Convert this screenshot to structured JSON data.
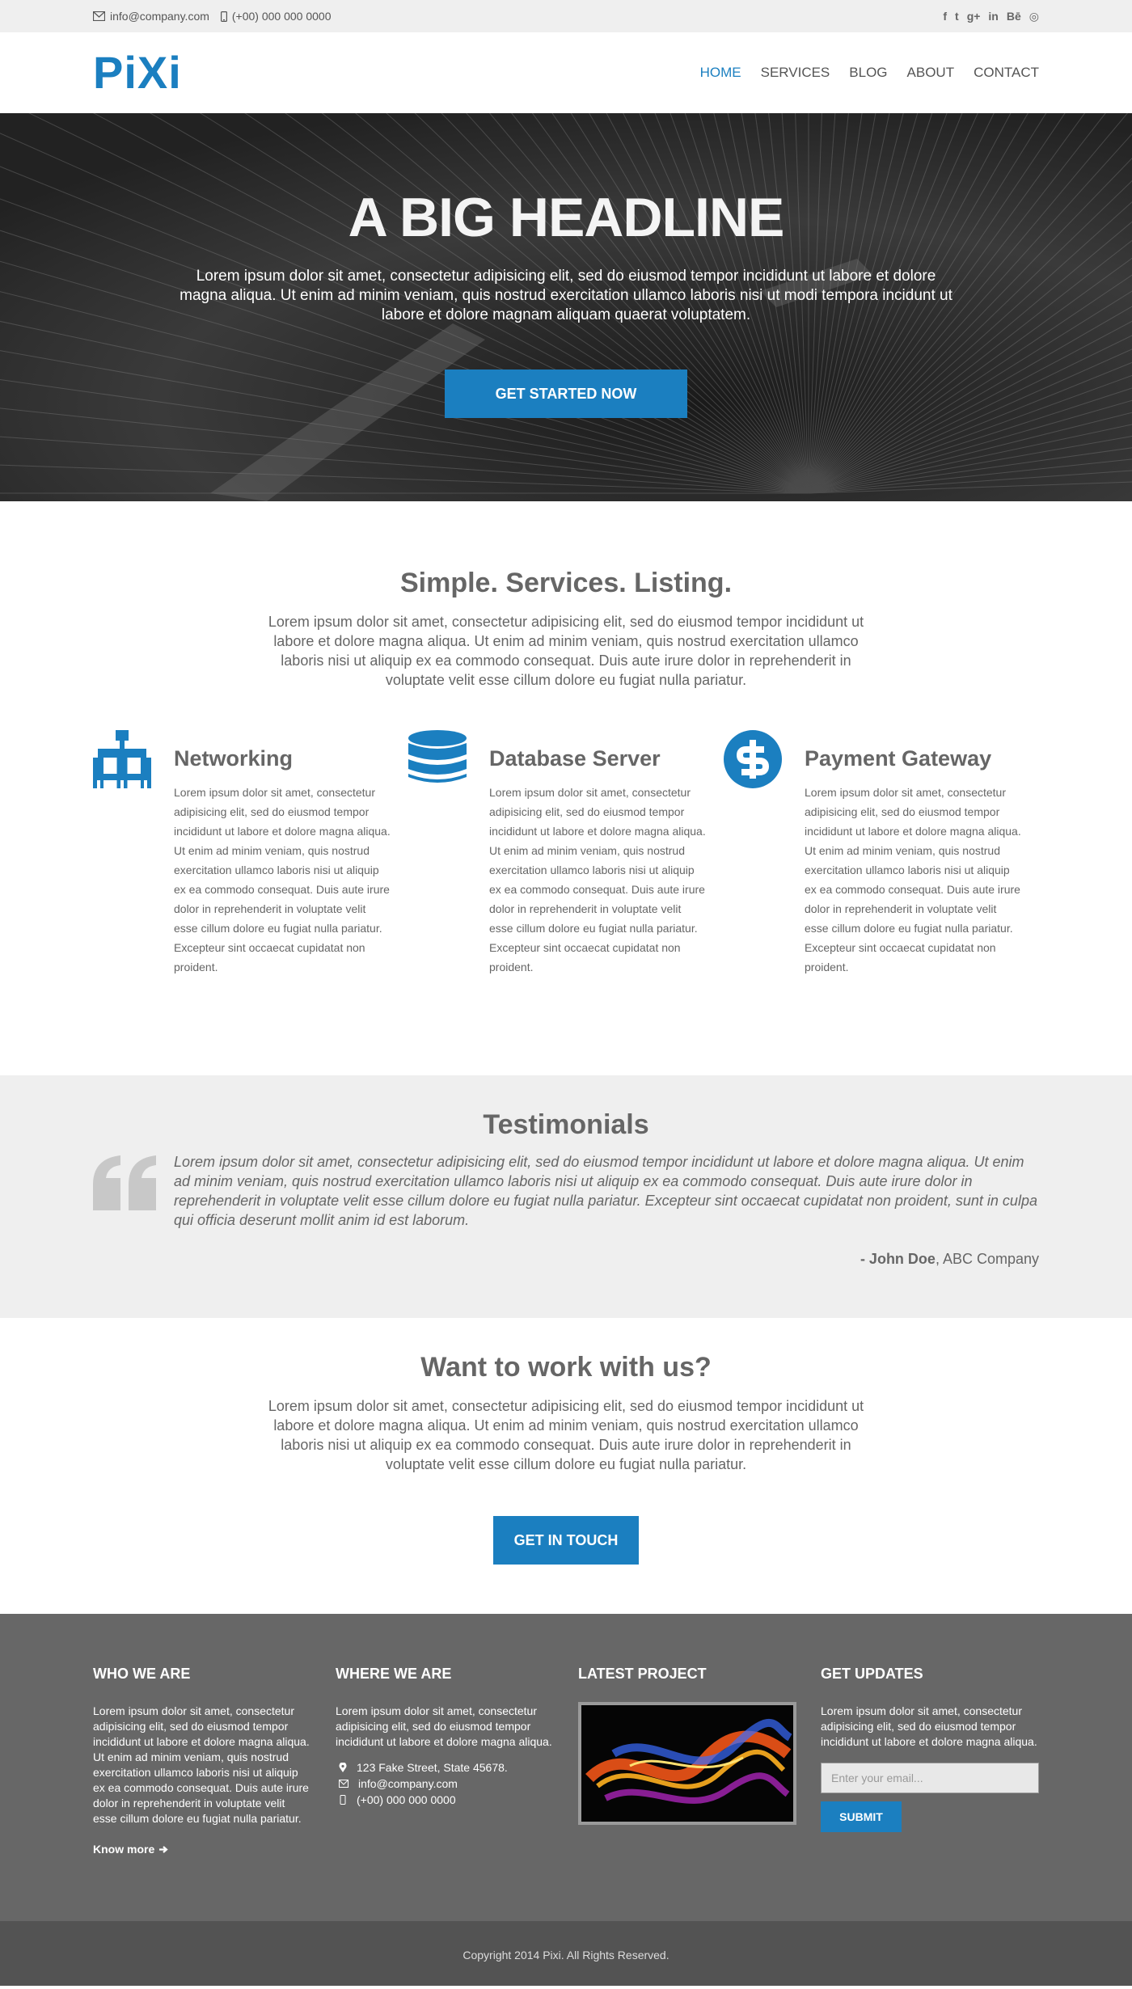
{
  "topbar": {
    "email": "info@company.com",
    "phone": "(+00) 000 000 0000",
    "social": [
      "f",
      "t",
      "g+",
      "in",
      "Bē",
      "◎"
    ]
  },
  "header": {
    "logo": "PiXi",
    "nav": [
      "HOME",
      "SERVICES",
      "BLOG",
      "ABOUT",
      "CONTACT"
    ],
    "active": "HOME"
  },
  "hero": {
    "headline": "A BIG HEADLINE",
    "text": "Lorem ipsum dolor sit amet, consectetur adipisicing elit, sed do eiusmod tempor incididunt ut labore et dolore magna aliqua. Ut enim ad minim veniam, quis nostrud exercitation ullamco laboris nisi ut modi tempora incidunt ut labore et dolore magnam aliquam quaerat voluptatem.",
    "cta": "GET STARTED NOW"
  },
  "services": {
    "title": "Simple. Services. Listing.",
    "intro": "Lorem ipsum dolor sit amet, consectetur adipisicing elit, sed do eiusmod tempor incididunt ut labore et dolore magna aliqua. Ut enim ad minim veniam, quis nostrud exercitation ullamco laboris nisi ut aliquip ex ea commodo consequat. Duis aute irure dolor in reprehenderit in voluptate velit esse cillum dolore eu fugiat nulla pariatur.",
    "items": [
      {
        "title": "Networking",
        "icon": "sitemap-icon",
        "text": "Lorem ipsum dolor sit amet, consectetur adipisicing elit, sed do eiusmod tempor incididunt ut labore et dolore magna aliqua. Ut enim ad minim veniam, quis nostrud exercitation ullamco laboris nisi ut aliquip ex ea commodo consequat. Duis aute irure dolor in reprehenderit in voluptate velit esse cillum dolore eu fugiat nulla pariatur. Excepteur sint occaecat cupidatat non proident."
      },
      {
        "title": "Database Server",
        "icon": "database-icon",
        "text": "Lorem ipsum dolor sit amet, consectetur adipisicing elit, sed do eiusmod tempor incididunt ut labore et dolore magna aliqua. Ut enim ad minim veniam, quis nostrud exercitation ullamco laboris nisi ut aliquip ex ea commodo consequat. Duis aute irure dolor in reprehenderit in voluptate velit esse cillum dolore eu fugiat nulla pariatur. Excepteur sint occaecat cupidatat non proident."
      },
      {
        "title": "Payment Gateway",
        "icon": "dollar-icon",
        "text": "Lorem ipsum dolor sit amet, consectetur adipisicing elit, sed do eiusmod tempor incididunt ut labore et dolore magna aliqua. Ut enim ad minim veniam, quis nostrud exercitation ullamco laboris nisi ut aliquip ex ea commodo consequat. Duis aute irure dolor in reprehenderit in voluptate velit esse cillum dolore eu fugiat nulla pariatur. Excepteur sint occaecat cupidatat non proident."
      }
    ]
  },
  "testimonials": {
    "title": "Testimonials",
    "quote": "Lorem ipsum dolor sit amet, consectetur adipisicing elit, sed do eiusmod tempor incididunt ut labore et dolore magna aliqua. Ut enim ad minim veniam, quis nostrud exercitation ullamco laboris nisi ut aliquip ex ea commodo consequat. Duis aute irure dolor in reprehenderit in voluptate velit esse cillum dolore eu fugiat nulla pariatur. Excepteur sint occaecat cupidatat non proident, sunt in culpa qui officia deserunt mollit anim id est laborum.",
    "author_name": "- John Doe",
    "author_company": ", ABC Company"
  },
  "work": {
    "title": "Want to work with us?",
    "text": "Lorem ipsum dolor sit amet, consectetur adipisicing elit, sed do eiusmod tempor incididunt ut labore et dolore magna aliqua. Ut enim ad minim veniam, quis nostrud exercitation ullamco laboris nisi ut aliquip ex ea commodo consequat. Duis aute irure dolor in reprehenderit in voluptate velit esse cillum dolore eu fugiat nulla pariatur.",
    "cta": "GET IN TOUCH"
  },
  "footer": {
    "who": {
      "title": "WHO WE ARE",
      "text": "Lorem ipsum dolor sit amet, consectetur adipisicing elit, sed do eiusmod tempor incididunt ut labore et dolore magna aliqua. Ut enim ad minim veniam, quis nostrud exercitation ullamco laboris nisi ut aliquip ex ea commodo consequat. Duis aute irure dolor in reprehenderit in voluptate velit esse cillum dolore eu fugiat nulla pariatur.",
      "more": "Know more"
    },
    "where": {
      "title": "WHERE WE ARE",
      "text": "Lorem ipsum dolor sit amet, consectetur adipisicing elit, sed do eiusmod tempor incididunt ut labore et dolore magna aliqua.",
      "address": "123 Fake Street, State 45678.",
      "email": "info@company.com",
      "phone": "(+00) 000 000 0000"
    },
    "project": {
      "title": "LATEST PROJECT"
    },
    "updates": {
      "title": "GET UPDATES",
      "text": "Lorem ipsum dolor sit amet, consectetur adipisicing elit, sed do eiusmod tempor incididunt ut labore et dolore magna aliqua.",
      "placeholder": "Enter your email...",
      "submit": "SUBMIT"
    },
    "copyright": "Copyright 2014 Pixi. All Rights Reserved."
  },
  "colors": {
    "accent": "#1b7fc0",
    "footer": "#676767",
    "copyright_bar": "#535353",
    "light_bg": "#efefef"
  }
}
